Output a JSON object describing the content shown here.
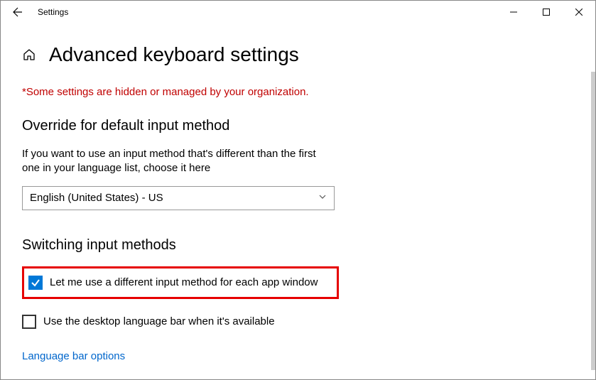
{
  "titlebar": {
    "title": "Settings"
  },
  "header": {
    "page_title": "Advanced keyboard settings"
  },
  "warning": "*Some settings are hidden or managed by your organization.",
  "override": {
    "section_title": "Override for default input method",
    "description": "If you want to use an input method that's different than the first one in your language list, choose it here",
    "dropdown_value": "English (United States) - US"
  },
  "switching": {
    "section_title": "Switching input methods",
    "option1_label": "Let me use a different input method for each app window",
    "option1_checked": true,
    "option2_label": "Use the desktop language bar when it's available",
    "option2_checked": false,
    "link_label": "Language bar options"
  }
}
